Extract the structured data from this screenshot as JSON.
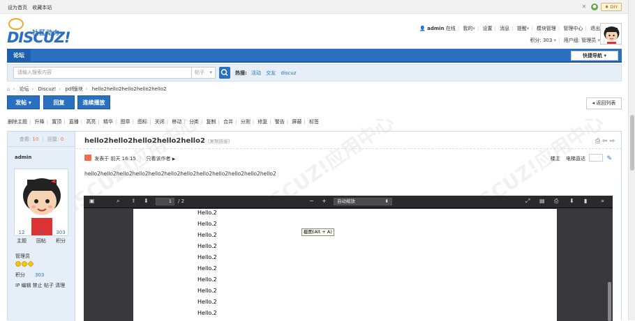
{
  "topbar": {
    "set_home": "设为首页",
    "bookmark": "收藏本站",
    "diy": "♦ DIY"
  },
  "logo": {
    "word": "DISCUZ!",
    "cn": "社区动力"
  },
  "user": {
    "name": "admin",
    "online": "在线",
    "mine": "我的",
    "settings": "设置",
    "messages": "消息",
    "reminders": "提醒",
    "module_mgmt": "模块管理",
    "admin_center": "管理中心",
    "logout": "退出",
    "credits_label": "积分: 303",
    "group_label": "用户组: 管理员"
  },
  "nav": {
    "forum": "论坛",
    "quicknav": "快捷导航"
  },
  "search": {
    "placeholder": "请输入搜索内容",
    "type": "帖子",
    "hot_label": "热搜:",
    "hot": [
      "活动",
      "交友",
      "discuz"
    ]
  },
  "breadcrumb": [
    "论坛",
    "Discuz!",
    "pdf版块",
    "hello2hello2hello2hello2hello2"
  ],
  "buttons": {
    "post": "发帖",
    "reply": "回复",
    "autoplay": "连续播放",
    "back_list": "返回列表"
  },
  "mod_actions": [
    "删除主题",
    "升降",
    "置顶",
    "直播",
    "高亮",
    "精华",
    "图章",
    "图标",
    "关闭",
    "移动",
    "分类",
    "复制",
    "合并",
    "分割",
    "修复",
    "警告",
    "屏蔽",
    "标签"
  ],
  "thread": {
    "views_label": "查看:",
    "views": "10",
    "replies_label": "回复:",
    "replies": "0",
    "title": "hello2hello2hello2hello2hello2",
    "copy_link": "[复制链接]",
    "posted": "发表于 前天 16:15",
    "only_author": "只看该作者",
    "floor_owner": "楼主",
    "goto_floor": "电梯直达",
    "content": "hello2hello2hello2hello2hello2hello2hello2hello2hello2hello2hello2hello2"
  },
  "author": {
    "name": "admin",
    "stats": [
      {
        "value": "12",
        "label": "主题"
      },
      {
        "value": "0",
        "label": "回帖"
      },
      {
        "value": "303",
        "label": "积分"
      }
    ],
    "group": "管理员",
    "credits_label": "积分",
    "credits": "303",
    "ops": "IP 编辑 禁止 帖子 清理"
  },
  "pdf": {
    "page": "1",
    "page_total": "/ 2",
    "zoom": "自动缩放",
    "lines": [
      "Hello.2",
      "Hello.2",
      "Hello.2",
      "Hello.2",
      "Hello.2",
      "Hello.2",
      "Hello.2",
      "Hello.2",
      "Hello.2",
      "Hello.2"
    ],
    "tooltip": "截图(Alt + A)"
  },
  "colors": {
    "accent": "#2b6fc0",
    "sidebar_bg": "#e6eef8",
    "viewer_bg": "#38383d"
  }
}
